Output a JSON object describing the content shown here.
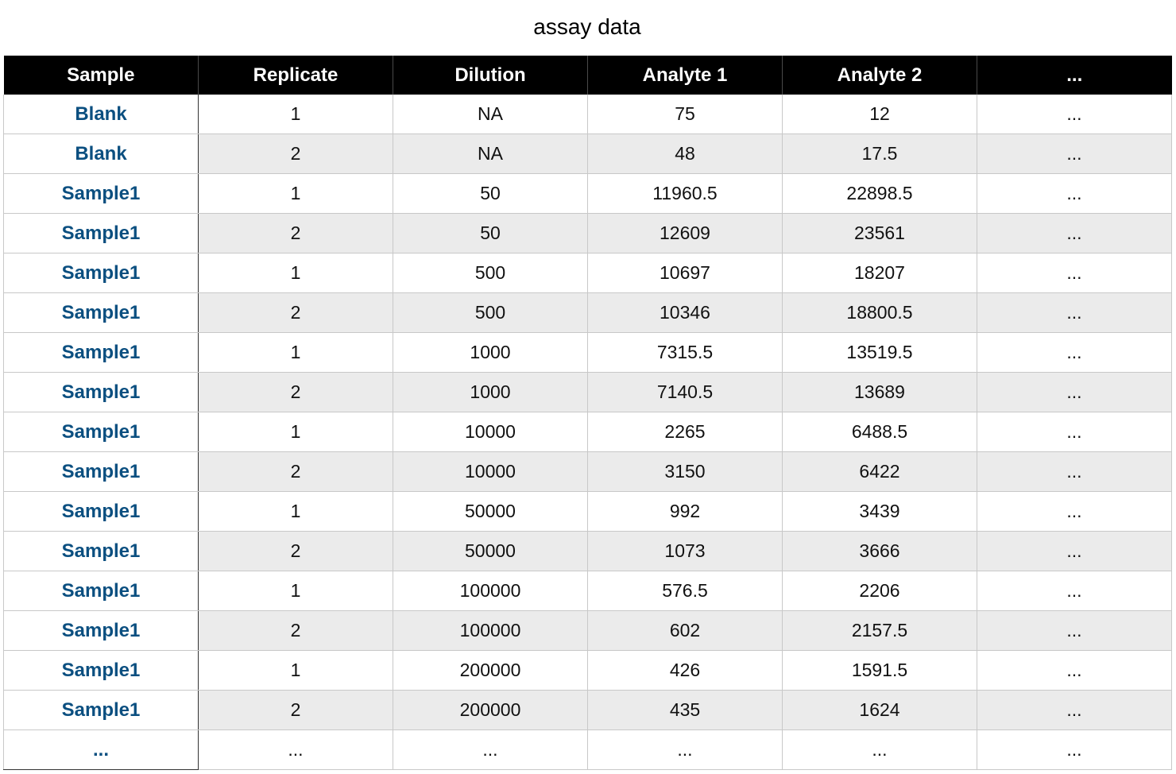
{
  "title": "assay data",
  "table": {
    "headers": [
      "Sample",
      "Replicate",
      "Dilution",
      "Analyte 1",
      "Analyte 2",
      "..."
    ],
    "rows": [
      [
        "Blank",
        "1",
        "NA",
        "75",
        "12",
        "..."
      ],
      [
        "Blank",
        "2",
        "NA",
        "48",
        "17.5",
        "..."
      ],
      [
        "Sample1",
        "1",
        "50",
        "11960.5",
        "22898.5",
        "..."
      ],
      [
        "Sample1",
        "2",
        "50",
        "12609",
        "23561",
        "..."
      ],
      [
        "Sample1",
        "1",
        "500",
        "10697",
        "18207",
        "..."
      ],
      [
        "Sample1",
        "2",
        "500",
        "10346",
        "18800.5",
        "..."
      ],
      [
        "Sample1",
        "1",
        "1000",
        "7315.5",
        "13519.5",
        "..."
      ],
      [
        "Sample1",
        "2",
        "1000",
        "7140.5",
        "13689",
        "..."
      ],
      [
        "Sample1",
        "1",
        "10000",
        "2265",
        "6488.5",
        "..."
      ],
      [
        "Sample1",
        "2",
        "10000",
        "3150",
        "6422",
        "..."
      ],
      [
        "Sample1",
        "1",
        "50000",
        "992",
        "3439",
        "..."
      ],
      [
        "Sample1",
        "2",
        "50000",
        "1073",
        "3666",
        "..."
      ],
      [
        "Sample1",
        "1",
        "100000",
        "576.5",
        "2206",
        "..."
      ],
      [
        "Sample1",
        "2",
        "100000",
        "602",
        "2157.5",
        "..."
      ],
      [
        "Sample1",
        "1",
        "200000",
        "426",
        "1591.5",
        "..."
      ],
      [
        "Sample1",
        "2",
        "200000",
        "435",
        "1624",
        "..."
      ],
      [
        "...",
        "...",
        "...",
        "...",
        "...",
        "..."
      ]
    ]
  },
  "colors": {
    "header_bg": "#000000",
    "header_text": "#ffffff",
    "sample_text": "#0b4f80",
    "stripe": "#ebebeb"
  }
}
